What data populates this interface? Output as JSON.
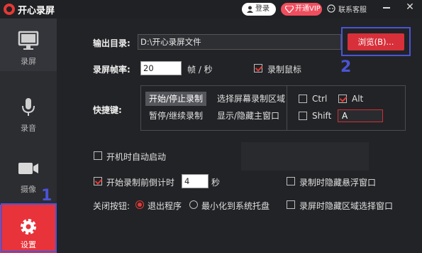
{
  "titlebar": {
    "app_title": "开心录屏",
    "login_label": "登录",
    "vip_label": "开通VIP",
    "contact_label": "联系客服"
  },
  "sidebar": {
    "items": [
      {
        "label": "录屏",
        "icon": "monitor-icon"
      },
      {
        "label": "录音",
        "icon": "microphone-icon"
      },
      {
        "label": "摄像",
        "icon": "camera-icon"
      },
      {
        "label": "设置",
        "icon": "gear-icon"
      }
    ],
    "active_index": 3
  },
  "annotations": {
    "marker_1": "1",
    "marker_2": "2",
    "color": "#4a54d6"
  },
  "settings": {
    "output_dir_label": "输出目录:",
    "output_dir_value": "D:\\开心录屏文件",
    "browse_label": "浏览(B)...",
    "fps_label": "录屏帧率:",
    "fps_value": "20",
    "fps_unit": "帧 / 秒",
    "record_mouse_label": "录制鼠标",
    "record_mouse_checked": true,
    "hotkey_label": "快捷键:",
    "hotkey_actions": [
      "开始/停止录制",
      "选择屏幕录制区域",
      "暂停/继续录制",
      "显示/隐藏主窗口"
    ],
    "hotkey_selected": 0,
    "ctrl_label": "Ctrl",
    "ctrl_checked": false,
    "alt_label": "Alt",
    "alt_checked": true,
    "shift_label": "Shift",
    "shift_checked": false,
    "key_value": "A",
    "autostart_label": "开机时自动启动",
    "autostart_checked": false,
    "countdown_label": "开始录制前倒计时",
    "countdown_checked": true,
    "countdown_value": "4",
    "countdown_unit": "秒",
    "hide_float_label": "录制时隐藏悬浮窗口",
    "hide_float_checked": false,
    "close_btn_label": "关闭按钮:",
    "exit_label": "退出程序",
    "minimize_label": "最小化到系统托盘",
    "close_selected": "exit",
    "hide_region_label": "录屏时隐藏区域选择窗口",
    "hide_region_checked": false
  },
  "colors": {
    "accent": "#e8333a",
    "background": "#222326",
    "sidebar": "#2c2d31"
  }
}
